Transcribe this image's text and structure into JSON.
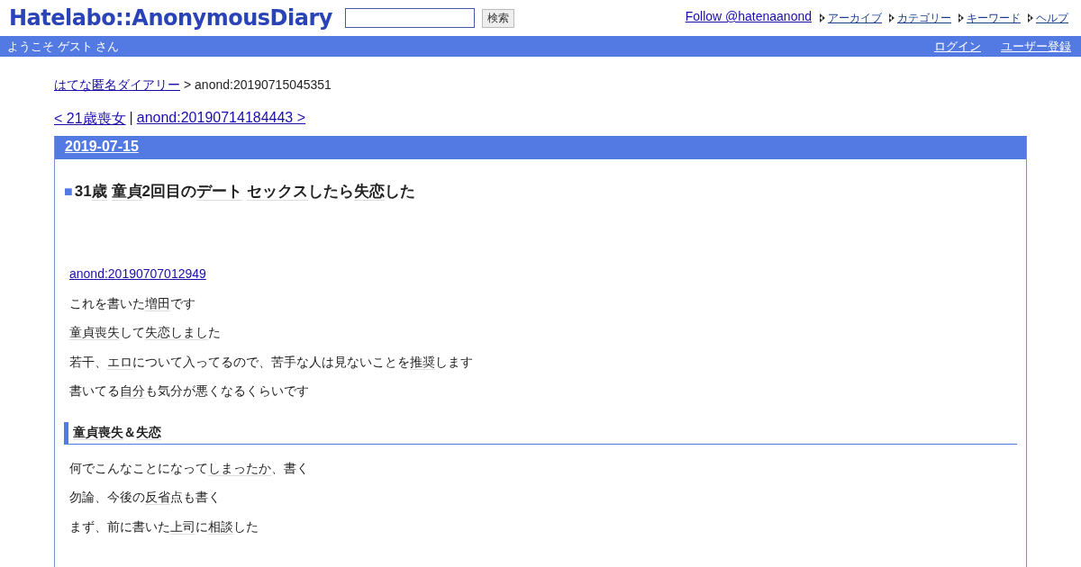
{
  "header": {
    "logo": "Hatelabo::AnonymousDiary",
    "search": {
      "button": "検索"
    },
    "follow": "Follow @hatenaanond",
    "nav": [
      "アーカイブ",
      "カテゴリー",
      "キーワード",
      "ヘルプ"
    ]
  },
  "welcome_bar": {
    "greeting": "ようこそ ゲスト さん",
    "links": [
      "ログイン",
      "ユーザー登録"
    ]
  },
  "breadcrumb": {
    "home": "はてな匿名ダイアリー",
    "current": "> anond:20190715045351"
  },
  "pager": {
    "prev": "< 21歳喪女",
    "separator": "|",
    "next": "anond:20190714184443 >"
  },
  "day": {
    "date": "2019-07-15",
    "entry": {
      "marker": "■",
      "title": [
        {
          "text": "31",
          "keyword": false
        },
        {
          "text": "歳",
          "keyword": true
        },
        {
          "text": "童貞",
          "keyword": true
        },
        {
          "text": "2回目の",
          "keyword": false
        },
        {
          "text": "デート",
          "keyword": true
        },
        {
          "text": "セックス",
          "keyword": true
        },
        {
          "text": "したら",
          "keyword": false
        },
        {
          "text": "失恋",
          "keyword": true
        },
        {
          "text": "した",
          "keyword": false
        }
      ],
      "blocks": [
        {
          "kind": "link",
          "text": "anond:20190707012949"
        },
        {
          "kind": "paragraph",
          "segments": [
            {
              "text": "これを書いた",
              "keyword": false
            },
            {
              "text": "増田",
              "keyword": true
            },
            {
              "text": "です",
              "keyword": false
            }
          ]
        },
        {
          "kind": "paragraph",
          "segments": [
            {
              "text": "童貞喪失",
              "keyword": true
            },
            {
              "text": "して",
              "keyword": false
            },
            {
              "text": "失恋しまし",
              "keyword": true
            },
            {
              "text": "た",
              "keyword": false
            }
          ]
        },
        {
          "kind": "paragraph",
          "segments": [
            {
              "text": "若干、",
              "keyword": false
            },
            {
              "text": "エロ",
              "keyword": true
            },
            {
              "text": "について入ってるので、苦手な人は見ないことを",
              "keyword": false
            },
            {
              "text": "推奨",
              "keyword": true
            },
            {
              "text": "します",
              "keyword": false
            }
          ]
        },
        {
          "kind": "paragraph",
          "segments": [
            {
              "text": "書いてる",
              "keyword": false
            },
            {
              "text": "自分",
              "keyword": true
            },
            {
              "text": "も気分が悪くなるくらいです",
              "keyword": false
            }
          ]
        },
        {
          "kind": "heading",
          "segments": [
            {
              "text": "童貞喪失",
              "keyword": true
            },
            {
              "text": "＆",
              "keyword": false
            },
            {
              "text": "失恋",
              "keyword": true
            }
          ]
        },
        {
          "kind": "paragraph",
          "segments": [
            {
              "text": "何でこんなことになって",
              "keyword": false
            },
            {
              "text": "しまったか",
              "keyword": true
            },
            {
              "text": "、書く",
              "keyword": false
            }
          ]
        },
        {
          "kind": "paragraph",
          "segments": [
            {
              "text": "勿論、今後の",
              "keyword": false
            },
            {
              "text": "反省",
              "keyword": true
            },
            {
              "text": "点も書く",
              "keyword": false
            }
          ]
        },
        {
          "kind": "paragraph",
          "segments": [
            {
              "text": "まず、前に書いた",
              "keyword": false
            },
            {
              "text": "上司",
              "keyword": true
            },
            {
              "text": "に",
              "keyword": false
            },
            {
              "text": "相談",
              "keyword": true
            },
            {
              "text": "した",
              "keyword": false
            }
          ]
        }
      ]
    }
  }
}
